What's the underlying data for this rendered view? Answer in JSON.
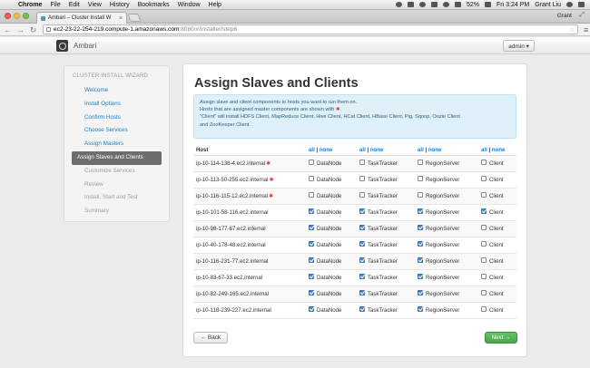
{
  "os_menubar": {
    "items": [
      "Chrome",
      "File",
      "Edit",
      "View",
      "History",
      "Bookmarks",
      "Window",
      "Help"
    ],
    "battery": "52%",
    "clock": "Fri 3:24 PM",
    "user": "Grant Liu"
  },
  "browser": {
    "tab_title": "Ambari – Cluster Install W",
    "tab_close": "×",
    "profile_name": "Grant",
    "url_host": "ec2-23-22-254-219.compute-1.amazonaws.com",
    "url_path": ":8080/#/installer/step6",
    "back_icon": "←",
    "forward_icon": "→",
    "reload_icon": "↻",
    "star_icon": "☆",
    "menu_icon": "≡",
    "expand_icon": "⤢"
  },
  "app": {
    "brand": "Ambari",
    "admin_button": "admin ▾"
  },
  "sidebar": {
    "title": "CLUSTER INSTALL WIZARD",
    "items": [
      {
        "label": "Welcome",
        "state": "done"
      },
      {
        "label": "Install Options",
        "state": "done"
      },
      {
        "label": "Confirm Hosts",
        "state": "done"
      },
      {
        "label": "Choose Services",
        "state": "done"
      },
      {
        "label": "Assign Masters",
        "state": "done"
      },
      {
        "label": "Assign Slaves and Clients",
        "state": "active"
      },
      {
        "label": "Customize Services",
        "state": "disabled"
      },
      {
        "label": "Review",
        "state": "disabled"
      },
      {
        "label": "Install, Start and Test",
        "state": "disabled"
      },
      {
        "label": "Summary",
        "state": "disabled"
      }
    ]
  },
  "main": {
    "title": "Assign Slaves and Clients",
    "alert_line1": "Assign slave and client components to hosts you want to run them on.",
    "alert_line2_pre": "Hosts that are assigned master components are shown with ",
    "alert_star": "✱",
    "alert_line2_post": ".",
    "alert_line3": "\"Client\" will install HDFS Client, MapReduce Client, Hive Client, HCat Client, HBase Client, Pig, Sqoop, Oozie Client",
    "alert_line4": "and ZooKeeper Client.",
    "table": {
      "host_header": "Host",
      "all_label": "all",
      "separator": "|",
      "none_label": "none",
      "columns": [
        "DataNode",
        "TaskTracker",
        "RegionServer",
        "Client"
      ],
      "rows": [
        {
          "host": "ip-10-114-138-4.ec2.internal",
          "master": true,
          "checks": [
            false,
            false,
            false,
            false
          ]
        },
        {
          "host": "ip-10-113-50-255.ec2.internal",
          "master": true,
          "checks": [
            false,
            false,
            false,
            false
          ]
        },
        {
          "host": "ip-10-116-115-12.ec2.internal",
          "master": true,
          "checks": [
            false,
            false,
            false,
            false
          ]
        },
        {
          "host": "ip-10-101-58-116.ec2.internal",
          "master": false,
          "checks": [
            true,
            true,
            true,
            true
          ]
        },
        {
          "host": "ip-10-98-177-67.ec2.internal",
          "master": false,
          "checks": [
            true,
            true,
            true,
            false
          ]
        },
        {
          "host": "ip-10-40-178-48.ec2.internal",
          "master": false,
          "checks": [
            true,
            true,
            true,
            false
          ]
        },
        {
          "host": "ip-10-116-231-77.ec2.internal",
          "master": false,
          "checks": [
            true,
            true,
            true,
            false
          ]
        },
        {
          "host": "ip-10-83-67-33.ec2.internal",
          "master": false,
          "checks": [
            true,
            true,
            true,
            false
          ]
        },
        {
          "host": "ip-10-82-249-165.ec2.internal",
          "master": false,
          "checks": [
            true,
            true,
            true,
            false
          ]
        },
        {
          "host": "ip-10-118-239-227.ec2.internal",
          "master": false,
          "checks": [
            true,
            true,
            true,
            false
          ]
        }
      ]
    },
    "back_button": "← Back",
    "next_button": "Next →"
  },
  "colors": {
    "link": "#1a7fc8",
    "active_nav": "#6d6d6d",
    "alert_bg": "#dff0f8",
    "required_star": "#e04040",
    "next_green": "#51a351"
  }
}
